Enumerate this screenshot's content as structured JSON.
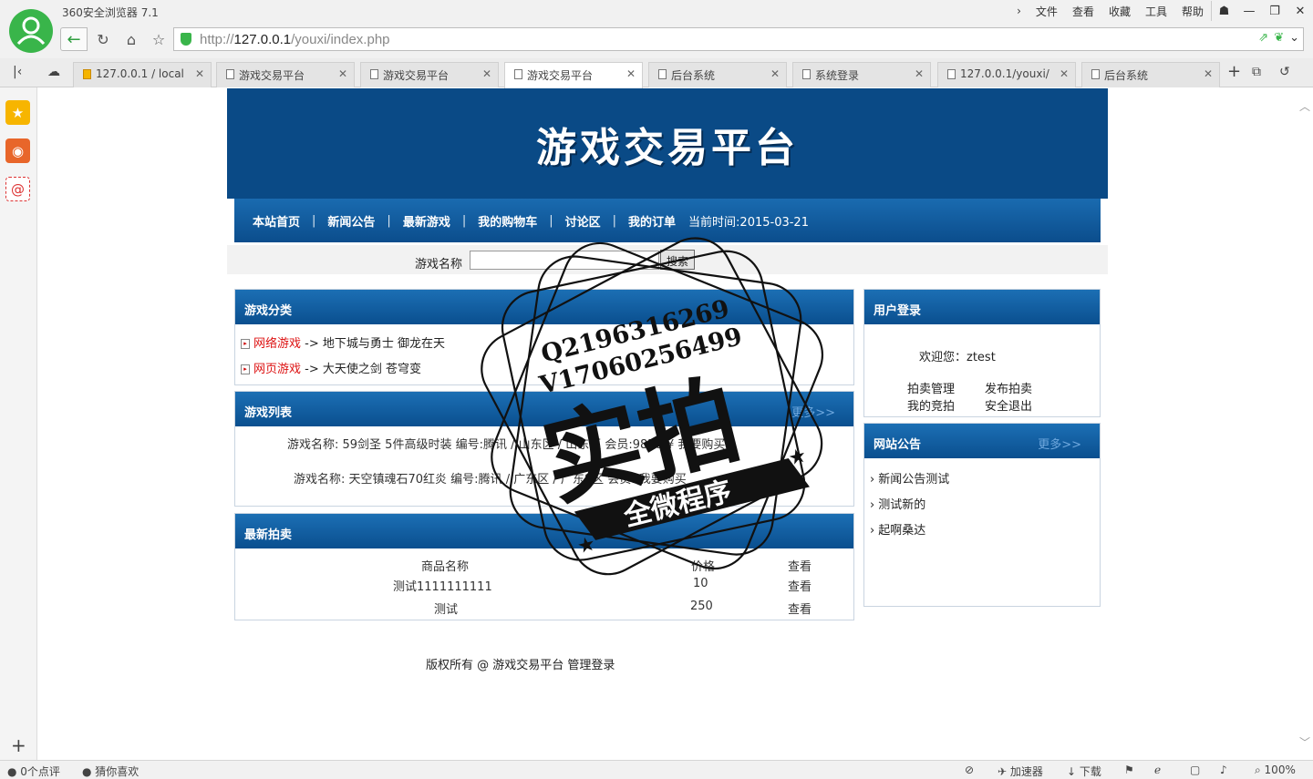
{
  "browser": {
    "app_title": "360安全浏览器 7.1",
    "menu": [
      "文件",
      "查看",
      "收藏",
      "工具",
      "帮助"
    ],
    "address": {
      "prefix": "http://",
      "host": "127.0.0.1",
      "path": "/youxi/index.php"
    },
    "tabs": [
      {
        "label": "127.0.0.1 / local"
      },
      {
        "label": "游戏交易平台"
      },
      {
        "label": "游戏交易平台"
      },
      {
        "label": "游戏交易平台"
      },
      {
        "label": "后台系统"
      },
      {
        "label": "系统登录"
      },
      {
        "label": "127.0.0.1/youxi/"
      },
      {
        "label": "后台系统"
      }
    ],
    "status": {
      "comments": "0个点评",
      "guess": "猜你喜欢",
      "accelerator": "加速器",
      "download": "下载",
      "zoom": "100%"
    }
  },
  "site": {
    "banner_title": "游戏交易平台",
    "nav": [
      "本站首页",
      "新闻公告",
      "最新游戏",
      "我的购物车",
      "讨论区",
      "我的订单"
    ],
    "nav_time": "当前时间:2015-03-21",
    "search": {
      "label": "游戏名称",
      "button": "搜索"
    },
    "category": {
      "title": "游戏分类",
      "rows": [
        {
          "type": "网络游戏",
          "arrow": "->",
          "items": "地下城与勇士  御龙在天"
        },
        {
          "type": "网页游戏",
          "arrow": "->",
          "items": "大天使之剑  苍穹变"
        }
      ]
    },
    "game_list": {
      "title": "游戏列表",
      "more": "更多>>",
      "rows": [
        {
          "text": "游戏名称: 59剑圣 5件高级时装 编号:腾讯 / 山东区 / 山东区   会员:9878 ¥   我要购买"
        },
        {
          "text": "游戏名称: 天空镇魂石70红炎 编号:腾讯 / 广东区 / 广东8区   会员:   我要购买"
        }
      ]
    },
    "auction": {
      "title": "最新拍卖",
      "headers": [
        "商品名称",
        "价格",
        "查看"
      ],
      "rows": [
        [
          "测试1111111111",
          "10",
          "查看"
        ],
        [
          "测试",
          "250",
          "查看"
        ]
      ]
    },
    "user_login": {
      "title": "用户登录",
      "welcome": "欢迎您：ztest",
      "links": [
        "拍卖管理",
        "发布拍卖",
        "我的竞拍",
        "安全退出"
      ]
    },
    "notices": {
      "title": "网站公告",
      "more": "更多>>",
      "items": [
        "新闻公告测试",
        "测试新的",
        "起啊桑达"
      ]
    },
    "footer": "版权所有 @ 游戏交易平台 管理登录"
  },
  "stamp": {
    "line1": "Q2196316269",
    "line2": "V17060256499",
    "big": "实拍",
    "ribbon": "全微程序"
  }
}
